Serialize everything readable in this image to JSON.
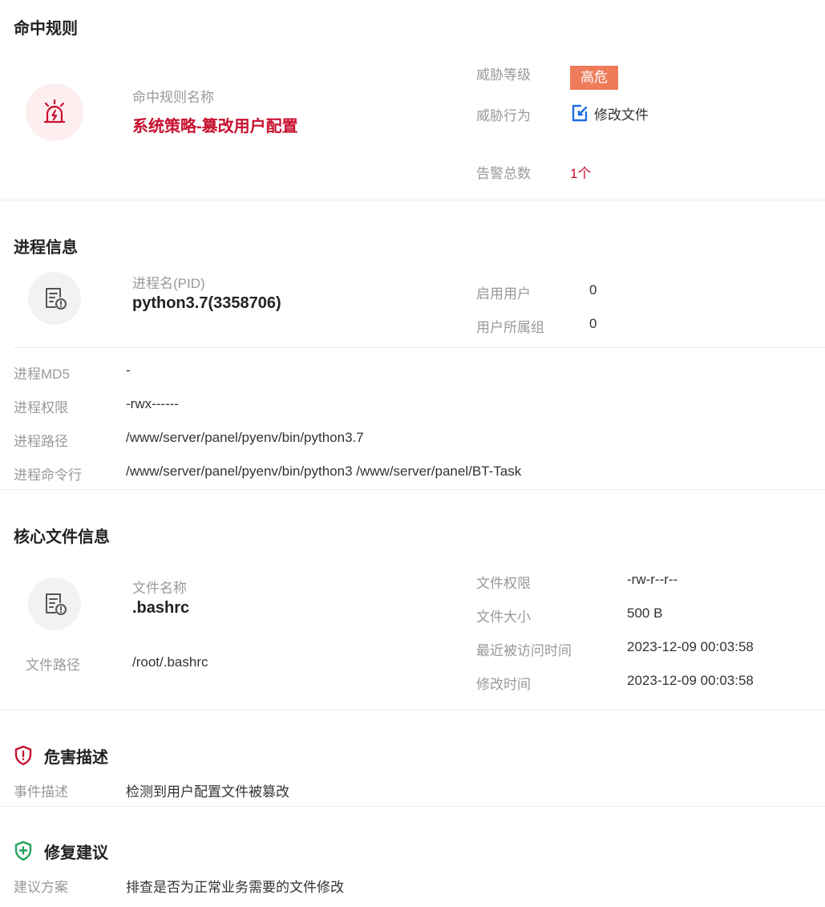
{
  "colors": {
    "danger": "#c8102e",
    "badge_bg": "#ee7b5a",
    "link_blue": "#1a6fe6",
    "safe_green": "#20a25a"
  },
  "rule": {
    "heading": "命中规则",
    "name_label": "命中规则名称",
    "name_value": "系统策略-篡改用户配置",
    "level_label": "威胁等级",
    "level_value": "高危",
    "behavior_label": "威胁行为",
    "behavior_value": "修改文件",
    "alarm_label": "告警总数",
    "alarm_value": "1个"
  },
  "process": {
    "heading": "进程信息",
    "name_label": "进程名(PID)",
    "name_value": "python3.7(3358706)",
    "user_label": "启用用户",
    "user_value": "0",
    "group_label": "用户所属组",
    "group_value": "0",
    "rows": [
      {
        "label": "进程MD5",
        "value": "-"
      },
      {
        "label": "进程权限",
        "value": "-rwx------"
      },
      {
        "label": "进程路径",
        "value": "/www/server/panel/pyenv/bin/python3.7"
      },
      {
        "label": "进程命令行",
        "value": "/www/server/panel/pyenv/bin/python3 /www/server/panel/BT-Task"
      }
    ]
  },
  "file": {
    "heading": "核心文件信息",
    "name_label": "文件名称",
    "name_value": ".bashrc",
    "path_label": "文件路径",
    "path_value": "/root/.bashrc",
    "perm_label": "文件权限",
    "perm_value": "-rw-r--r--",
    "size_label": "文件大小",
    "size_value": "500 B",
    "access_label": "最近被访问时间",
    "access_value": "2023-12-09 00:03:58",
    "modify_label": "修改时间",
    "modify_value": "2023-12-09 00:03:58"
  },
  "harm": {
    "heading": "危害描述",
    "label": "事件描述",
    "value": "检测到用户配置文件被篡改"
  },
  "fix": {
    "heading": "修复建议",
    "label": "建议方案",
    "value": "排查是否为正常业务需要的文件修改"
  }
}
